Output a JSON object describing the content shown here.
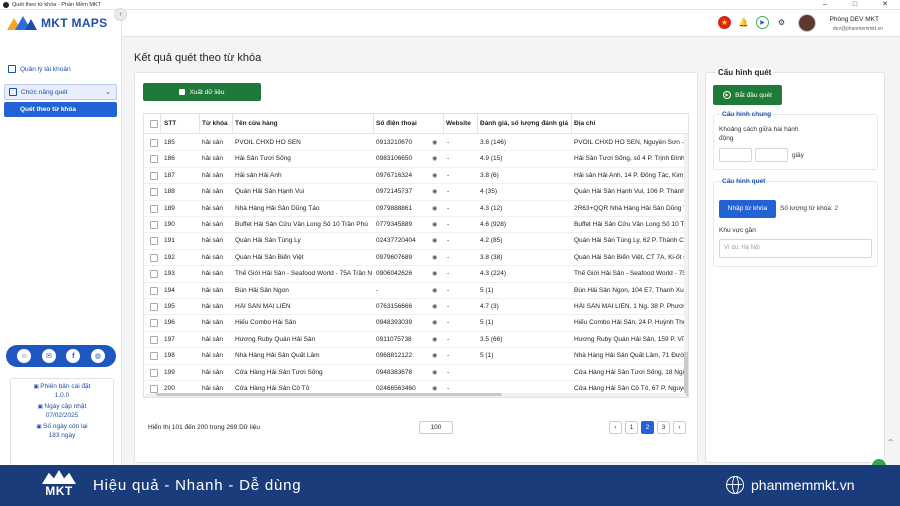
{
  "window": {
    "title": "Quét theo từ khóa - Phần Mềm MKT"
  },
  "sidebar": {
    "logo_text": "MKT MAPS",
    "items": [
      {
        "label": "Quản lý tài khoản"
      },
      {
        "label": "Chức năng quét"
      },
      {
        "label": "Quét theo từ khóa"
      }
    ],
    "info": {
      "version_label": "Phiên bản cài đặt",
      "version_value": "1.0.0",
      "update_label": "Ngày cập nhật",
      "update_value": "07/02/2025",
      "remaining_label": "Số ngày còn lại",
      "remaining_value": "183 ngày"
    }
  },
  "header": {
    "user_name": "Phòng DEV MKT",
    "user_email": "dev@phanmemmkt.vn"
  },
  "main": {
    "title": "Kết quả quét theo từ khóa",
    "export_label": "Xuất dữ liệu",
    "columns": [
      "STT",
      "Từ khóa",
      "Tên cửa hàng",
      "Số điện thoại",
      "Website",
      "Đánh giá, số lượng đánh giá",
      "Địa chỉ"
    ],
    "rows": [
      {
        "stt": "185",
        "kw": "hải sản",
        "name": "PVOIL CHXD HỒ SEN",
        "phone": "0913210670",
        "web": "-",
        "rating": "3.8 (146)",
        "addr": "PVOIL CHXD HỒ SEN, Nguyễn Sơn - L"
      },
      {
        "stt": "186",
        "kw": "hải sản",
        "name": "Hải Sản Tươi Sống",
        "phone": "0983106650",
        "web": "-",
        "rating": "4.9 (15)",
        "addr": "Hải Sản Tươi Sống, số 4 P. Trịnh Đình C"
      },
      {
        "stt": "187",
        "kw": "hải sản",
        "name": "Hải sản Hải Anh",
        "phone": "0976716324",
        "web": "-",
        "rating": "3.8 (6)",
        "addr": "Hải sản Hải Anh, 14 P. Đông Tác, Kim L"
      },
      {
        "stt": "188",
        "kw": "hải sản",
        "name": "Quán Hải Sản Hạnh Vui",
        "phone": "0972145737",
        "web": "-",
        "rating": "4 (35)",
        "addr": "Quán Hải Sản Hạnh Vui, 106 P. Thành C"
      },
      {
        "stt": "189",
        "kw": "hải sản",
        "name": "Nhà Hàng Hải Sản Dũng Táo",
        "phone": "0979888861",
        "web": "-",
        "rating": "4.3 (12)",
        "addr": "2R63+QQR Nhà Hàng Hải Sản Dũng Tá"
      },
      {
        "stt": "190",
        "kw": "hải sản",
        "name": "Buffet Hải Sản Cửu Vân Long Số 10 Trần Phú",
        "phone": "0779345889",
        "web": "-",
        "rating": "4.6 (928)",
        "addr": "Buffet Hải Sản Cửu Vân Long Số 10 Tr"
      },
      {
        "stt": "191",
        "kw": "hải sản",
        "name": "Quán Hải Sản Tùng Ly",
        "phone": "02437720404",
        "web": "-",
        "rating": "4.2 (85)",
        "addr": "Quán Hải Sản Tùng Ly, 62 P. Thành Cô"
      },
      {
        "stt": "192",
        "kw": "hải sản",
        "name": "Quán Hải Sản Biển Việt",
        "phone": "0979607689",
        "web": "-",
        "rating": "3.8 (38)",
        "addr": "Quán Hải Sản Biển Việt, CT 7A, Ki-ốt s"
      },
      {
        "stt": "193",
        "kw": "hải sản",
        "name": "Thế Giới Hải Sản - Seafood World - 75A Trần Nhân Tông",
        "phone": "0906042626",
        "web": "-",
        "rating": "4.3 (224)",
        "addr": "Thế Giới Hải Sản - Seafood World - 75"
      },
      {
        "stt": "194",
        "kw": "hải sản",
        "name": "Bún Hải Sản Ngon",
        "phone": "-",
        "web": "-",
        "rating": "5 (1)",
        "addr": "Bún Hải Sản Ngon, 104 E7, Thanh Xuâ"
      },
      {
        "stt": "195",
        "kw": "hải sản",
        "name": "HẢI SẢN MAI LIÊN",
        "phone": "0763156666",
        "web": "-",
        "rating": "4.7 (3)",
        "addr": "HẢI SẢN MAI LIÊN, 1 Ng. 38 P. Phương"
      },
      {
        "stt": "196",
        "kw": "hải sản",
        "name": "Hiếu Combo Hải Sản",
        "phone": "0948393039",
        "web": "-",
        "rating": "5 (1)",
        "addr": "Hiếu Combo Hải Sản, 24 P. Huỳnh Thú"
      },
      {
        "stt": "197",
        "kw": "hải sản",
        "name": "Hương Ruby Quán Hải Sản",
        "phone": "0911075738",
        "web": "-",
        "rating": "3.5 (66)",
        "addr": "Hương Ruby Quán Hải Sản, 159 P. Vĩnh"
      },
      {
        "stt": "198",
        "kw": "hải sản",
        "name": "Nhà Hàng Hải Sản Quất Lâm",
        "phone": "0968812122",
        "web": "-",
        "rating": "5 (1)",
        "addr": "Nhà Hàng Hải Sản Quất Lâm, 71 Đườn"
      },
      {
        "stt": "199",
        "kw": "hải sản",
        "name": "Cửa Hàng Hải Sản Tươi Sống",
        "phone": "0948383678",
        "web": "-",
        "rating": "",
        "addr": "Cửa Hàng Hải Sản Tươi Sống, 18 Ngõ"
      },
      {
        "stt": "200",
        "kw": "hải sản",
        "name": "Cửa Hàng Hải Sản Cô Tô",
        "phone": "02466563460",
        "web": "-",
        "rating": "",
        "addr": "Cửa Hàng Hải Sản Cô Tô, 67 P. Nguyễ"
      }
    ],
    "pager": {
      "info": "Hiển thị 101 đến 200 trong 269 Dữ liệu",
      "page_size": "100",
      "prev": "‹",
      "next": "›",
      "pages": [
        "1",
        "2",
        "3"
      ],
      "active": "2"
    }
  },
  "config": {
    "title": "Cấu hình quét",
    "start_label": "Bắt đầu quét",
    "general": {
      "title": "Cấu hình chung",
      "interval_label": "Khoảng cách giữa hai hành động",
      "unit": "giây"
    },
    "scan": {
      "title": "Cấu hình quét",
      "import_label": "Nhập từ khóa",
      "keyword_count_label": "Số lượng từ khóa:",
      "keyword_count": "2",
      "area_label": "Khu vực gần",
      "area_placeholder": "Ví dụ: Hà Nội"
    }
  },
  "banner": {
    "logo": "MKT",
    "slogan": "Hiệu quả - Nhanh - Dễ dùng",
    "site": "phanmemmkt.vn"
  },
  "colors": {
    "primary": "#2362d4",
    "green": "#1f7a3a",
    "banner": "#1a3c7a"
  }
}
